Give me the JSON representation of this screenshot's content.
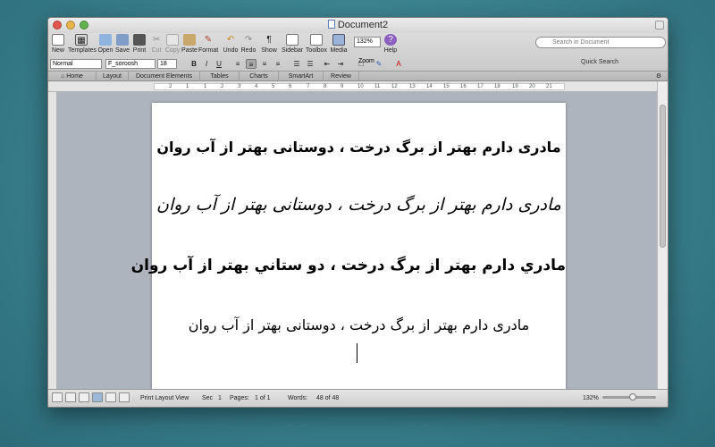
{
  "window": {
    "title": "Document2"
  },
  "toolbar": {
    "buttons": [
      {
        "id": "new",
        "label": "New",
        "icon": "new-doc-icon"
      },
      {
        "id": "templates",
        "label": "Templates",
        "icon": "templates-icon"
      },
      {
        "id": "open",
        "label": "Open",
        "icon": "open-folder-icon"
      },
      {
        "id": "save",
        "label": "Save",
        "icon": "save-disk-icon"
      },
      {
        "id": "print",
        "label": "Print",
        "icon": "printer-icon"
      },
      {
        "id": "cut",
        "label": "Cut",
        "icon": "scissors-icon"
      },
      {
        "id": "copy",
        "label": "Copy",
        "icon": "copy-icon"
      },
      {
        "id": "paste",
        "label": "Paste",
        "icon": "paste-clipboard-icon"
      },
      {
        "id": "format",
        "label": "Format",
        "icon": "format-brush-icon"
      },
      {
        "id": "undo",
        "label": "Undo",
        "icon": "undo-icon"
      },
      {
        "id": "redo",
        "label": "Redo",
        "icon": "redo-icon"
      },
      {
        "id": "show",
        "label": "Show",
        "icon": "pilcrow-icon"
      },
      {
        "id": "sidebar",
        "label": "Sidebar",
        "icon": "sidebar-icon"
      },
      {
        "id": "toolbox",
        "label": "Toolbox",
        "icon": "toolbox-icon"
      },
      {
        "id": "media",
        "label": "Media",
        "icon": "media-icon"
      },
      {
        "id": "help",
        "label": "Help",
        "icon": "help-icon"
      }
    ],
    "zoom_value": "132%",
    "zoom_label": "Zoom",
    "search_placeholder": "Search in Document",
    "quick_search_label": "Quick Search"
  },
  "format": {
    "style": "Normal",
    "font": "F_soroosh",
    "size": "18",
    "bold": "B",
    "italic": "I",
    "underline": "U"
  },
  "ribbon_tabs": [
    "Home",
    "Layout",
    "Document Elements",
    "Tables",
    "Charts",
    "SmartArt",
    "Review"
  ],
  "ruler_marks": [
    "2",
    "1",
    "1",
    "2",
    "3",
    "4",
    "5",
    "6",
    "7",
    "8",
    "9",
    "10",
    "11",
    "12",
    "13",
    "14",
    "15",
    "16",
    "17",
    "18",
    "19",
    "20",
    "21"
  ],
  "document": {
    "lines": [
      "مادری دارم بهتر از برگ درخت ، دوستانی بهتر از آب روان",
      "مادری دارم بهتر از برگ درخت ، دوستانی بهتر از آب روان",
      "مادري دارم بهتر از برگ درخت ، دو ستاني بهتر از آب روان",
      "مادری دارم بهتر از برگ درخت ، دوستانی بهتر از آب روان"
    ]
  },
  "status": {
    "view": "Print Layout View",
    "sec_label": "Sec",
    "sec_value": "1",
    "pages_label": "Pages:",
    "pages_value": "1 of 1",
    "words_label": "Words:",
    "words_value": "48 of 48",
    "zoom": "132%"
  }
}
